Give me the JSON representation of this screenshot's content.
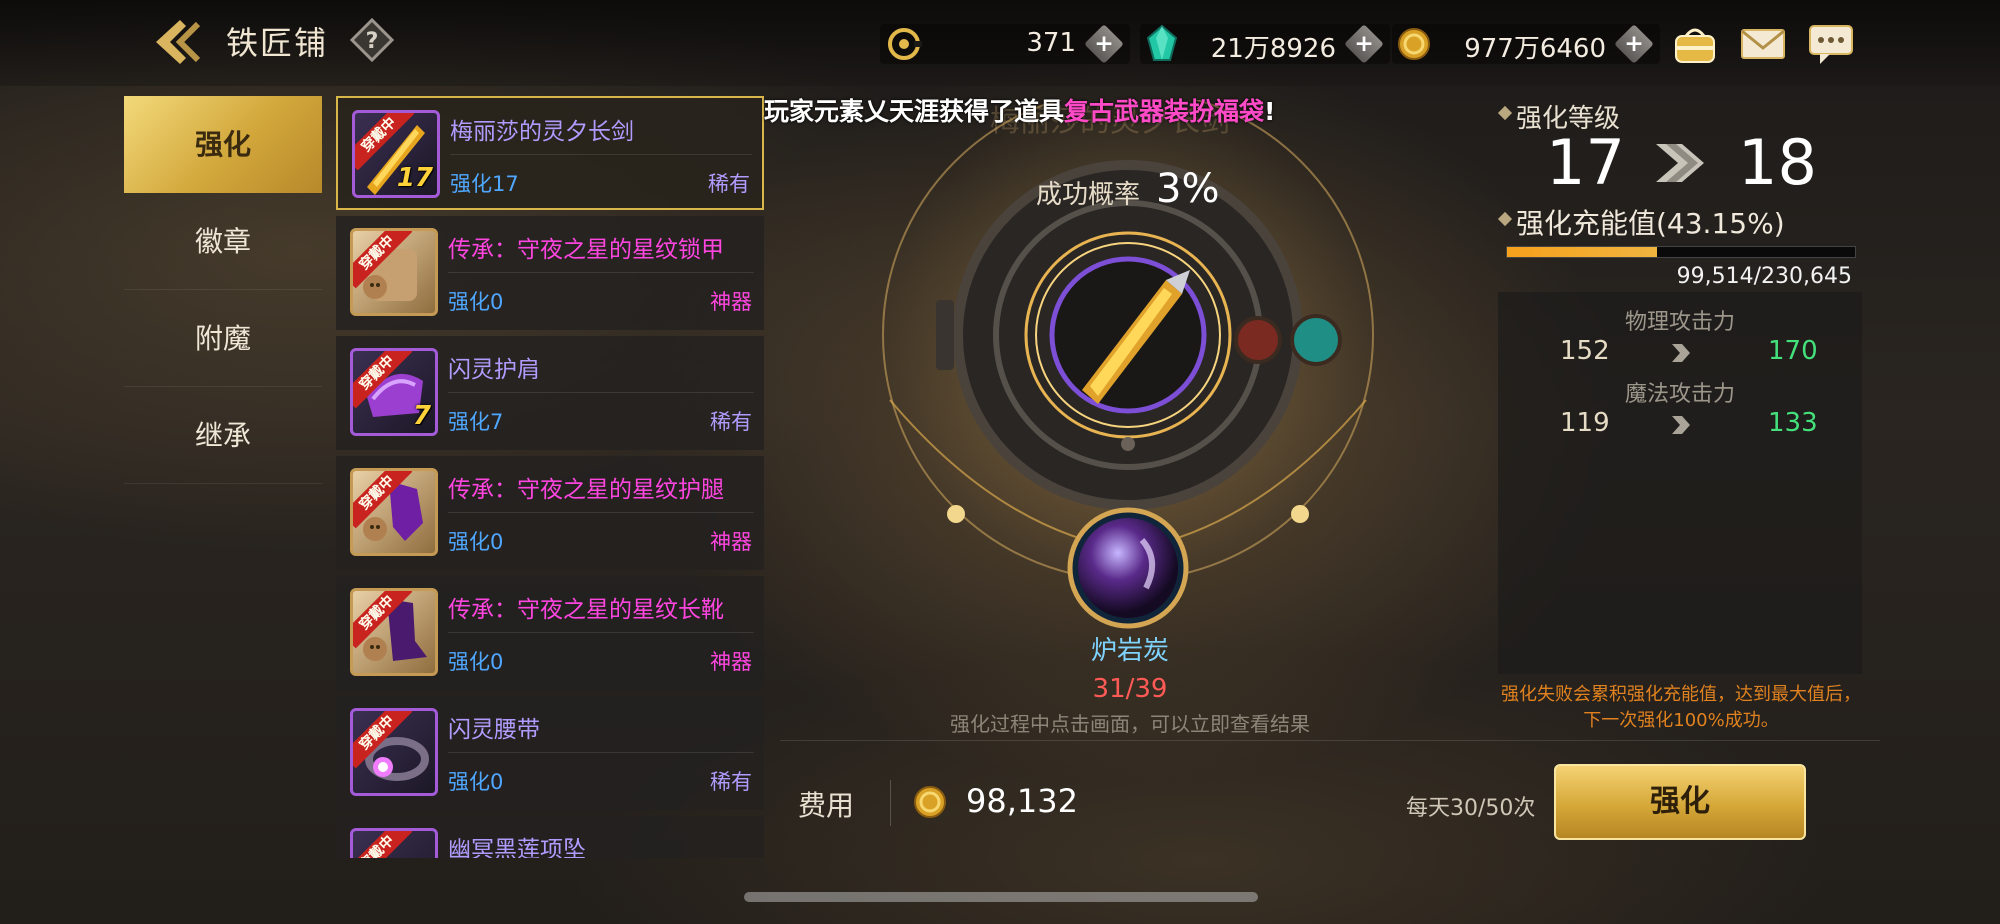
{
  "header": {
    "title": "铁匠铺",
    "currencies": [
      {
        "icon": "gold-c-icon",
        "value": "371"
      },
      {
        "icon": "gem-icon",
        "value": "21万8926"
      },
      {
        "icon": "coin-icon",
        "value": "977万6460"
      }
    ],
    "icons": [
      "bag-icon",
      "mail-icon",
      "chat-icon"
    ]
  },
  "tabs": [
    {
      "label": "强化",
      "active": true
    },
    {
      "label": "徽章",
      "active": false
    },
    {
      "label": "附魔",
      "active": false
    },
    {
      "label": "继承",
      "active": false
    }
  ],
  "items": [
    {
      "name": "梅丽莎的灵夕长剑",
      "enh": "强化17",
      "rarity": "稀有",
      "badge": "穿戴中",
      "level": "17",
      "legend": false,
      "selected": true
    },
    {
      "name": "传承：守夜之星的星纹锁甲",
      "enh": "强化0",
      "rarity": "神器",
      "badge": "穿戴中",
      "level": "",
      "legend": true,
      "selected": false
    },
    {
      "name": "闪灵护肩",
      "enh": "强化7",
      "rarity": "稀有",
      "badge": "穿戴中",
      "level": "7",
      "legend": false,
      "selected": false
    },
    {
      "name": "传承：守夜之星的星纹护腿",
      "enh": "强化0",
      "rarity": "神器",
      "badge": "穿戴中",
      "level": "",
      "legend": true,
      "selected": false
    },
    {
      "name": "传承：守夜之星的星纹长靴",
      "enh": "强化0",
      "rarity": "神器",
      "badge": "穿戴中",
      "level": "",
      "legend": true,
      "selected": false
    },
    {
      "name": "闪灵腰带",
      "enh": "强化0",
      "rarity": "稀有",
      "badge": "穿戴中",
      "level": "",
      "legend": false,
      "selected": false
    },
    {
      "name": "幽冥黑莲项坠",
      "enh": "",
      "rarity": "",
      "badge": "穿戴中",
      "level": "",
      "legend": false,
      "selected": false
    }
  ],
  "notice": {
    "prefix": "玩家元素乂天涯获得了道具",
    "item": "复古武器装扮福袋",
    "suffix": "!"
  },
  "center": {
    "ghost_title": "梅丽莎的灵夕长剑",
    "success_label": "成功概率",
    "success_rate": "3%",
    "material_name": "炉岩炭",
    "material_count": "31/39",
    "hint": "强化过程中点击画面，可以立即查看结果"
  },
  "right": {
    "level_label": "强化等级",
    "level_from": "17",
    "level_to": "18",
    "energy_label": "强化充能值(43.15%)",
    "energy_fraction": 0.4315,
    "energy_value": "99,514/230,645",
    "stats": [
      {
        "name": "物理攻击力",
        "old": "152",
        "new": "170"
      },
      {
        "name": "魔法攻击力",
        "old": "119",
        "new": "133"
      }
    ],
    "fail_note": "强化失败会累积强化充能值，达到最大值后，下一次强化100%成功。"
  },
  "footer": {
    "cost_label": "费用",
    "cost_value": "98,132",
    "daily_limit": "每天30/50次",
    "enhance_label": "强化"
  },
  "colors": {
    "accent_gold": "#d5a838",
    "rare_purple": "#b29bff",
    "artifact_pink": "#ff45e0",
    "enhance_blue": "#4fa7ff",
    "stat_green": "#44e07b",
    "fail_red": "#ff5a56"
  }
}
